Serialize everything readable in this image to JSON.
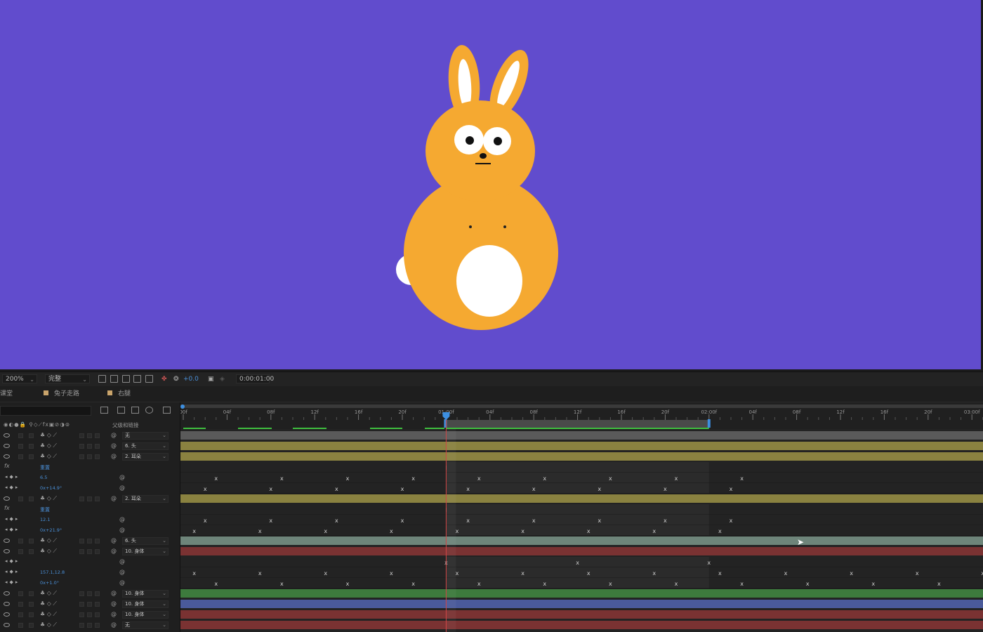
{
  "viewer": {
    "background": "#614ccd",
    "character": "rabbit",
    "zoom": "200%",
    "resolution": "完整",
    "exposure": "+0.0",
    "timecode": "0:00:01:00"
  },
  "tabs": [
    {
      "label": "课堂",
      "swatch": ""
    },
    {
      "label": "兔子走路",
      "swatch": "#c9a46b"
    },
    {
      "label": "右腿",
      "swatch": "#c9a46b"
    }
  ],
  "columns": {
    "parent_header": "父级和链接"
  },
  "layers": [
    {
      "type": "layer",
      "parent": "无",
      "bar_color": "#5a5a5a"
    },
    {
      "type": "layer",
      "parent": "6. 头",
      "bar_color": "#8a8240"
    },
    {
      "type": "layer",
      "parent": "2. 耳朵",
      "bar_color": "#8a8240"
    },
    {
      "type": "effect",
      "label": "重置"
    },
    {
      "type": "prop",
      "value": "6.5"
    },
    {
      "type": "prop",
      "value": "0x+14.9°"
    },
    {
      "type": "layer",
      "parent": "2. 耳朵",
      "bar_color": "#8a8240"
    },
    {
      "type": "effect",
      "label": "重置"
    },
    {
      "type": "prop",
      "value": "12.1"
    },
    {
      "type": "prop",
      "value": "0x+21.9°"
    },
    {
      "type": "layer",
      "parent": "6. 头",
      "bar_color": "#6e857a"
    },
    {
      "type": "layer",
      "parent": "10. 身体",
      "bar_color": "#7a3232"
    },
    {
      "type": "prop",
      "value": ""
    },
    {
      "type": "prop",
      "value": "157.1,12.8"
    },
    {
      "type": "prop",
      "value": "0x+1.0°"
    },
    {
      "type": "layer",
      "parent": "10. 身体",
      "bar_color": "#3d7a3d"
    },
    {
      "type": "layer",
      "parent": "10. 身体",
      "bar_color": "#4a5a9a"
    },
    {
      "type": "layer",
      "parent": "10. 身体",
      "bar_color": "#7a3232"
    },
    {
      "type": "layer",
      "parent": "无",
      "bar_color": "#7a3232"
    }
  ],
  "ruler": [
    "00f",
    "04f",
    "08f",
    "12f",
    "16f",
    "20f",
    "01:00f",
    "04f",
    "08f",
    "12f",
    "16f",
    "20f",
    "02:00f",
    "04f",
    "08f",
    "12f",
    "16f",
    "20f",
    "03:00f"
  ],
  "colors": {
    "playhead": "#d04545",
    "work_area_marker": "#3d8fe0",
    "keyframe": "#d0d0d0",
    "accent_text": "#4a90d9"
  }
}
